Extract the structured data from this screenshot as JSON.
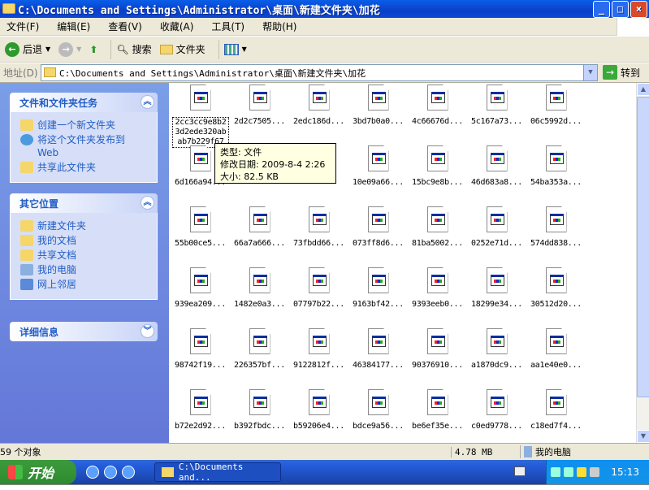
{
  "window": {
    "title": "C:\\Documents and Settings\\Administrator\\桌面\\新建文件夹\\加花",
    "minimize": "_",
    "maximize": "□",
    "close": "×"
  },
  "menu": [
    "文件(F)",
    "编辑(E)",
    "查看(V)",
    "收藏(A)",
    "工具(T)",
    "帮助(H)"
  ],
  "toolbar": {
    "back": "后退",
    "search": "搜索",
    "folders": "文件夹"
  },
  "address": {
    "label": "地址(D)",
    "value": "C:\\Documents and Settings\\Administrator\\桌面\\新建文件夹\\加花",
    "go": "转到"
  },
  "panels": [
    {
      "title": "文件和文件夹任务",
      "chevron": "︽",
      "items": [
        "创建一个新文件夹",
        "将这个文件夹发布到 Web",
        "共享此文件夹"
      ]
    },
    {
      "title": "其它位置",
      "chevron": "︽",
      "items": [
        "新建文件夹",
        "我的文档",
        "共享文档",
        "我的电脑",
        "网上邻居"
      ]
    },
    {
      "title": "详细信息",
      "chevron": "︾",
      "items": []
    }
  ],
  "files": [
    "2cc3cc9e8b23d2ede320abab7b229f67",
    "2d2c7505...",
    "2edc186d...",
    "3bd7b0a0...",
    "4c66676d...",
    "5c167a73...",
    "06c5992d...",
    "6d166a94...",
    "",
    "",
    "10e09a66...",
    "15bc9e8b...",
    "46d683a8...",
    "54ba353a...",
    "55b00ce5...",
    "66a7a666...",
    "73fbdd66...",
    "073ff8d6...",
    "81ba5002...",
    "0252e71d...",
    "574dd838...",
    "939ea209...",
    "1482e0a3...",
    "07797b22...",
    "9163bf42...",
    "9393eeb0...",
    "18299e34...",
    "30512d20...",
    "98742f19...",
    "226357bf...",
    "9122812f...",
    "46384177...",
    "90376910...",
    "a1870dc9...",
    "aa1e40e0...",
    "b72e2d92...",
    "b392fbdc...",
    "b59206e4...",
    "bdce9a56...",
    "be6ef35e...",
    "c0ed9778...",
    "c18ed7f4..."
  ],
  "tooltip": {
    "type": "类型: 文件",
    "modified": "修改日期: 2009-8-4 2:26",
    "size": "大小: 82.5 KB"
  },
  "status": {
    "count": "59 个对象",
    "size": "4.78 MB",
    "location": "我的电脑"
  },
  "taskbar": {
    "start": "开始",
    "task": "C:\\Documents and...",
    "clock": "15:13"
  }
}
